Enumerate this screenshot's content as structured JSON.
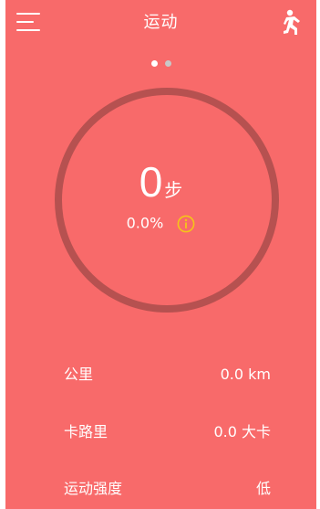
{
  "header": {
    "title": "运动",
    "menu_icon": "hamburger-menu-icon",
    "run_icon": "running-man-icon"
  },
  "pager": {
    "pages": 2,
    "current": 1
  },
  "progress": {
    "steps": "0",
    "steps_unit": "步",
    "percent_text": "0.0%",
    "percent": 0,
    "info_icon": "info-icon"
  },
  "stats": {
    "distance": {
      "label": "公里",
      "value": "0.0 km"
    },
    "calories": {
      "label": "卡路里",
      "value": "0.0 大卡"
    },
    "intensity": {
      "label": "运动强度",
      "value": "低"
    }
  },
  "colors": {
    "background": "#F86A6A",
    "ring": "#B65150",
    "text": "#FFFFFF",
    "info_accent": "#F5C518"
  }
}
